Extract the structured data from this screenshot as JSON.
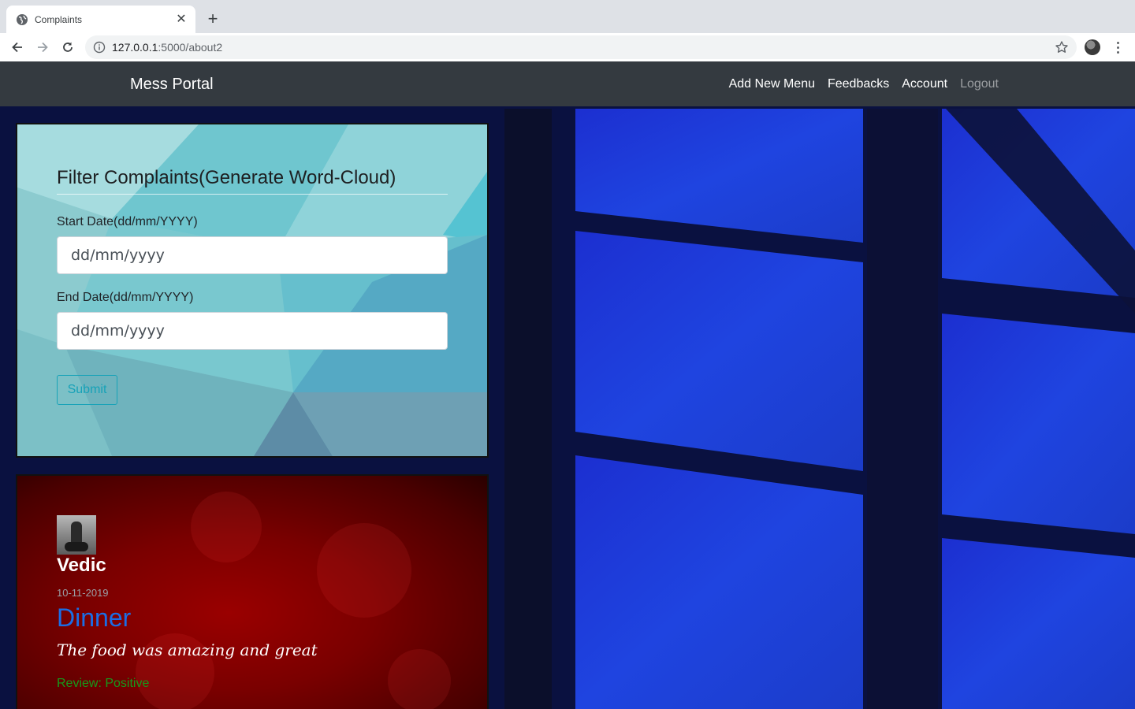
{
  "browser": {
    "tab_title": "Complaints",
    "url_host": "127.0.0.1",
    "url_path": ":5000/about2"
  },
  "navbar": {
    "brand": "Mess Portal",
    "links": [
      "Add New Menu",
      "Feedbacks",
      "Account",
      "Logout"
    ]
  },
  "filter_form": {
    "title": "Filter Complaints(Generate Word-Cloud)",
    "start_label": "Start Date(dd/mm/YYYY)",
    "start_placeholder": "dd/mm/yyyy",
    "end_label": "End Date(dd/mm/YYYY)",
    "end_placeholder": "dd/mm/yyyy",
    "submit_label": "Submit"
  },
  "complaint": {
    "user": "Vedic",
    "date": "10-11-2019",
    "meal": "Dinner",
    "text": "The food was amazing and great",
    "review": "Review: Positive"
  },
  "icons": [
    "globe-icon",
    "close-icon",
    "plus-icon",
    "back-arrow-icon",
    "forward-arrow-icon",
    "reload-icon",
    "info-icon",
    "star-icon",
    "kebab-menu-icon"
  ],
  "colors": {
    "navbar_bg": "#343a40",
    "submit_outline": "#17a2b8",
    "meal_title": "#1a6fe6",
    "review_text": "#169a1b"
  }
}
